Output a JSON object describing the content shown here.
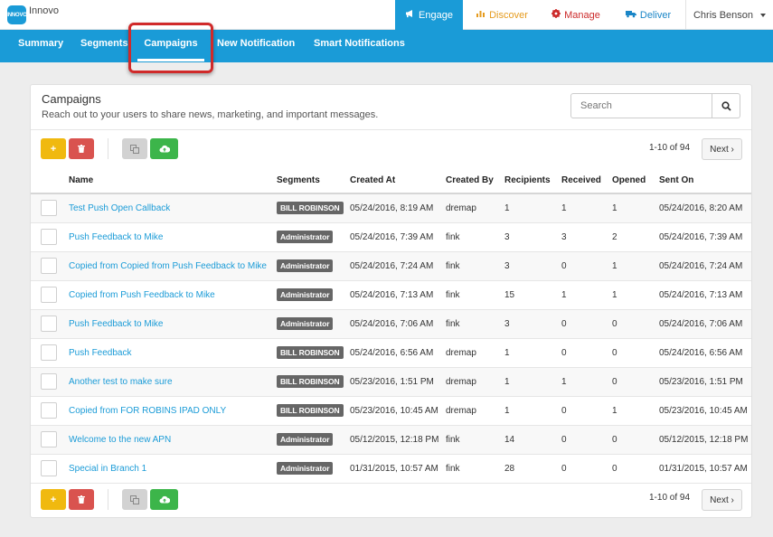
{
  "app": {
    "logo_mark": "INNOVO",
    "name": "Innovo"
  },
  "topnav": {
    "engage": "Engage",
    "discover": "Discover",
    "manage": "Manage",
    "deliver": "Deliver",
    "user": "Chris Benson"
  },
  "subnav": [
    "Summary",
    "Segments",
    "Campaigns",
    "New Notification",
    "Smart Notifications"
  ],
  "panel": {
    "title": "Campaigns",
    "subtitle": "Reach out to your users to share news, marketing, and important messages.",
    "search_placeholder": "Search",
    "page_count": "1-10 of 94",
    "next_label": "Next ›",
    "add_symbol": "+"
  },
  "columns": [
    "Name",
    "Segments",
    "Created At",
    "Created By",
    "Recipients",
    "Received",
    "Opened",
    "Sent On"
  ],
  "rows": [
    [
      "Test Push Open Callback",
      "BILL ROBINSON",
      "05/24/2016, 8:19 AM",
      "dremap",
      "1",
      "1",
      "1",
      "05/24/2016, 8:20 AM"
    ],
    [
      "Push Feedback to Mike",
      "Administrator",
      "05/24/2016, 7:39 AM",
      "fink",
      "3",
      "3",
      "2",
      "05/24/2016, 7:39 AM"
    ],
    [
      "Copied from Copied from Push Feedback to Mike",
      "Administrator",
      "05/24/2016, 7:24 AM",
      "fink",
      "3",
      "0",
      "1",
      "05/24/2016, 7:24 AM"
    ],
    [
      "Copied from Push Feedback to Mike",
      "Administrator",
      "05/24/2016, 7:13 AM",
      "fink",
      "15",
      "1",
      "1",
      "05/24/2016, 7:13 AM"
    ],
    [
      "Push Feedback to Mike",
      "Administrator",
      "05/24/2016, 7:06 AM",
      "fink",
      "3",
      "0",
      "0",
      "05/24/2016, 7:06 AM"
    ],
    [
      "Push Feedback",
      "BILL ROBINSON",
      "05/24/2016, 6:56 AM",
      "dremap",
      "1",
      "0",
      "0",
      "05/24/2016, 6:56 AM"
    ],
    [
      "Another test to make sure",
      "BILL ROBINSON",
      "05/23/2016, 1:51 PM",
      "dremap",
      "1",
      "1",
      "0",
      "05/23/2016, 1:51 PM"
    ],
    [
      "Copied from FOR ROBINS IPAD ONLY",
      "BILL ROBINSON",
      "05/23/2016, 10:45 AM",
      "dremap",
      "1",
      "0",
      "1",
      "05/23/2016, 10:45 AM"
    ],
    [
      "Welcome to the new APN",
      "Administrator",
      "05/12/2015, 12:18 PM",
      "fink",
      "14",
      "0",
      "0",
      "05/12/2015, 12:18 PM"
    ],
    [
      "Special in Branch 1",
      "Administrator",
      "01/31/2015, 10:57 AM",
      "fink",
      "28",
      "0",
      "0",
      "01/31/2015, 10:57 AM"
    ]
  ],
  "colors": {
    "accent": "#1a9bd7",
    "highlight": "#d02a2a"
  }
}
